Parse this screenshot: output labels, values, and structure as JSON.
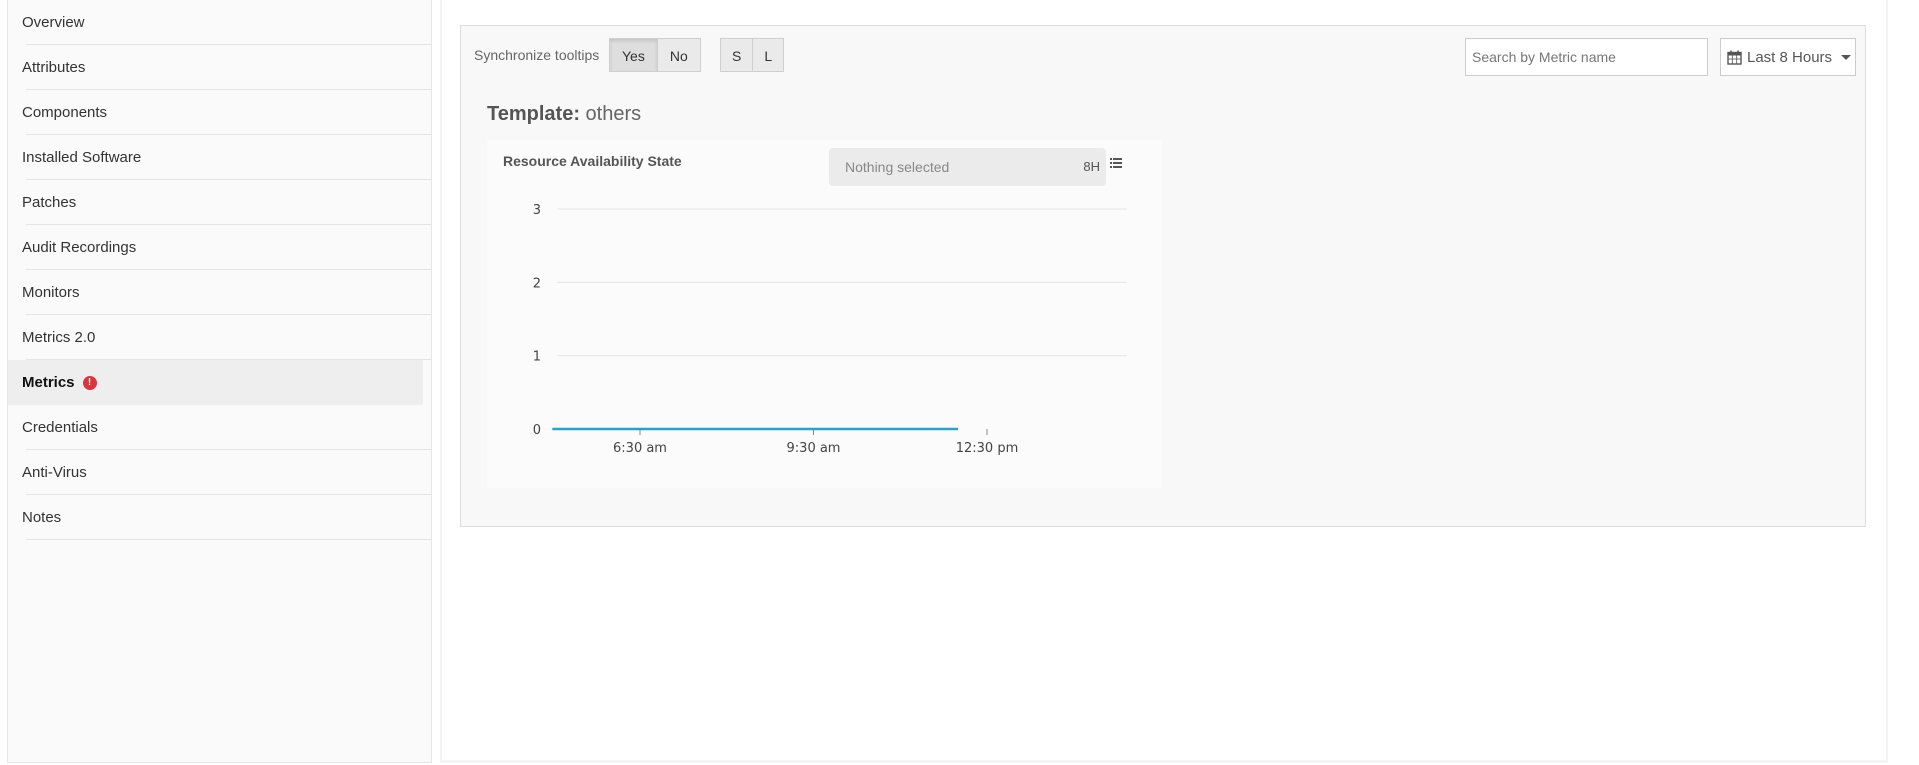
{
  "sidebar": {
    "items": [
      {
        "label": "Overview"
      },
      {
        "label": "Attributes"
      },
      {
        "label": "Components"
      },
      {
        "label": "Installed Software"
      },
      {
        "label": "Patches"
      },
      {
        "label": "Audit Recordings"
      },
      {
        "label": "Monitors"
      },
      {
        "label": "Metrics 2.0"
      },
      {
        "label": "Metrics",
        "active": true,
        "badge": "!"
      },
      {
        "label": "Credentials"
      },
      {
        "label": "Anti-Virus"
      },
      {
        "label": "Notes"
      }
    ]
  },
  "toolbar": {
    "sync_label": "Synchronize tooltips",
    "yes_label": "Yes",
    "no_label": "No",
    "size_s_label": "S",
    "size_l_label": "L",
    "search_placeholder": "Search by Metric name",
    "time_range_label": "Last 8 Hours",
    "time_range_icon": "calendar-icon"
  },
  "template": {
    "prefix": "Template:",
    "name": "others"
  },
  "chart_panel": {
    "title": "Resource Availability State",
    "select_placeholder": "Nothing selected",
    "range_tag": "8H",
    "list_icon": "list-icon"
  },
  "chart_data": {
    "type": "line",
    "title": "Resource Availability State",
    "xlabel": "",
    "ylabel": "",
    "x_tick_labels": [
      "6:30 am",
      "9:30 am",
      "12:30 pm"
    ],
    "y_tick_labels": [
      "0",
      "1",
      "2",
      "3"
    ],
    "ylim": [
      0,
      3
    ],
    "grid": true,
    "series": [
      {
        "x": [
          "4:59 am",
          "5:30 am",
          "6:30 am",
          "7:30 am",
          "8:30 am",
          "9:30 am",
          "10:30 am",
          "11:30 am",
          "12:00 pm"
        ],
        "values": [
          0,
          0,
          0,
          0,
          0,
          0,
          0,
          0,
          0
        ],
        "color": "#29a3cc"
      }
    ]
  },
  "colors": {
    "accent_line": "#29a3cc",
    "badge": "#d9363e"
  }
}
